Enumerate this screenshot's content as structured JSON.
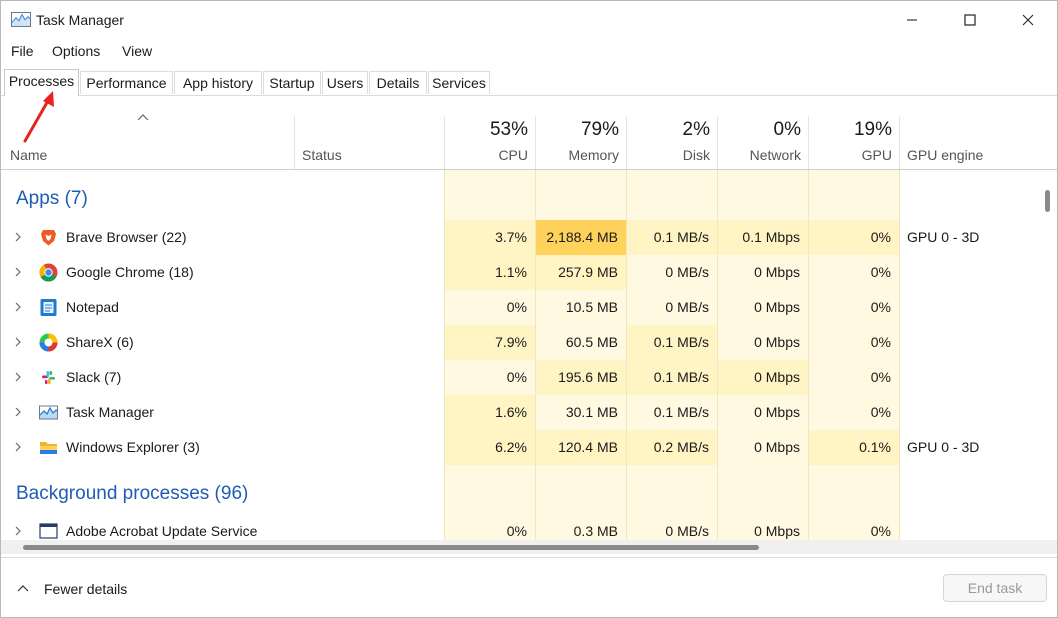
{
  "window": {
    "title": "Task Manager"
  },
  "menu": [
    "File",
    "Options",
    "View"
  ],
  "tabs": [
    "Processes",
    "Performance",
    "App history",
    "Startup",
    "Users",
    "Details",
    "Services"
  ],
  "active_tab": "Processes",
  "header": {
    "name": "Name",
    "status": "Status",
    "cpu": {
      "pct": "53%",
      "label": "CPU"
    },
    "memory": {
      "pct": "79%",
      "label": "Memory"
    },
    "disk": {
      "pct": "2%",
      "label": "Disk"
    },
    "network": {
      "pct": "0%",
      "label": "Network"
    },
    "gpu": {
      "pct": "19%",
      "label": "GPU"
    },
    "gpu_engine": "GPU engine"
  },
  "apps_group": "Apps (7)",
  "apps": [
    {
      "name": "Brave Browser (22)",
      "icon": "brave-icon",
      "cpu": "3.7%",
      "mem": "2,188.4 MB",
      "disk": "0.1 MB/s",
      "net": "0.1 Mbps",
      "gpu": "0%",
      "gpu_engine": "GPU 0 - 3D"
    },
    {
      "name": "Google Chrome (18)",
      "icon": "chrome-icon",
      "cpu": "1.1%",
      "mem": "257.9 MB",
      "disk": "0 MB/s",
      "net": "0 Mbps",
      "gpu": "0%",
      "gpu_engine": ""
    },
    {
      "name": "Notepad",
      "icon": "notepad-icon",
      "cpu": "0%",
      "mem": "10.5 MB",
      "disk": "0 MB/s",
      "net": "0 Mbps",
      "gpu": "0%",
      "gpu_engine": ""
    },
    {
      "name": "ShareX (6)",
      "icon": "sharex-icon",
      "cpu": "7.9%",
      "mem": "60.5 MB",
      "disk": "0.1 MB/s",
      "net": "0 Mbps",
      "gpu": "0%",
      "gpu_engine": ""
    },
    {
      "name": "Slack (7)",
      "icon": "slack-icon",
      "cpu": "0%",
      "mem": "195.6 MB",
      "disk": "0.1 MB/s",
      "net": "0 Mbps",
      "gpu": "0%",
      "gpu_engine": ""
    },
    {
      "name": "Task Manager",
      "icon": "task-manager-icon",
      "cpu": "1.6%",
      "mem": "30.1 MB",
      "disk": "0.1 MB/s",
      "net": "0 Mbps",
      "gpu": "0%",
      "gpu_engine": ""
    },
    {
      "name": "Windows Explorer (3)",
      "icon": "folder-icon",
      "cpu": "6.2%",
      "mem": "120.4 MB",
      "disk": "0.2 MB/s",
      "net": "0 Mbps",
      "gpu": "0.1%",
      "gpu_engine": "GPU 0 - 3D"
    }
  ],
  "background_group": "Background processes (96)",
  "background": [
    {
      "name": "Adobe Acrobat Update Service",
      "icon": "service-icon",
      "cpu": "0%",
      "mem": "0.3 MB",
      "disk": "0 MB/s",
      "net": "0 Mbps",
      "gpu": "0%",
      "gpu_engine": ""
    }
  ],
  "footer": {
    "fewer_details": "Fewer details",
    "end_task": "End task"
  },
  "colors": {
    "cell_light": "#fff9e1",
    "cell_mid": "#fff4c4",
    "cell_hot": "#ffd35b",
    "group_text": "#1d5db5",
    "annotation_arrow": "#e8231f"
  }
}
